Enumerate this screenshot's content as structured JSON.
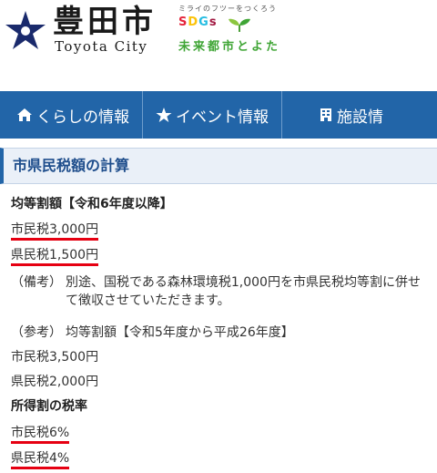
{
  "header": {
    "logo_title": "豊田市",
    "logo_subtitle": "Toyota City",
    "sdgs_tagline": "ミライのフツーをつくろう",
    "sdgs_logo": [
      "S",
      "D",
      "G",
      "s"
    ],
    "sdgs_slogan": "未来都市とよた"
  },
  "nav": {
    "items": [
      {
        "icon": "home-icon",
        "label": "くらしの情報"
      },
      {
        "icon": "star-icon",
        "label": "イベント情報"
      },
      {
        "icon": "building-icon",
        "label": "施設情"
      }
    ]
  },
  "section": {
    "title": "市県民税額の計算"
  },
  "content": {
    "heading1": "均等割額【令和6年度以降】",
    "city_tax_1": "市民税3,000円",
    "pref_tax_1": "県民税1,500円",
    "note_label": "（備考）",
    "note_text": "別途、国税である森林環境税1,000円を市県民税均等割に併せて徴収させていただきます。",
    "ref_label": "（参考）",
    "ref_text": "均等割額【令和5年度から平成26年度】",
    "city_tax_ref": "市民税3,500円",
    "pref_tax_ref": "県民税2,000円",
    "heading2": "所得割の税率",
    "city_rate": "市民税6%",
    "pref_rate": "県民税4%"
  },
  "colors": {
    "nav_background": "#2265a8",
    "underline": "#e60012",
    "section_title": "#1f4e8c",
    "slogan_green": "#3fa535"
  }
}
